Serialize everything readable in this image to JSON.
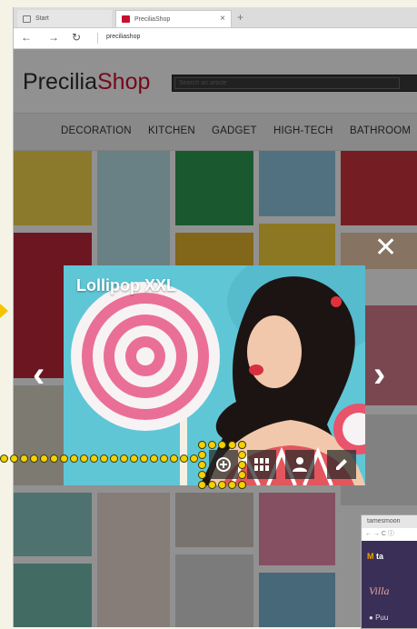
{
  "browser": {
    "tabs": [
      {
        "label": "Start"
      },
      {
        "label": "PreciliaShop"
      }
    ],
    "url": "preciliashop"
  },
  "shop": {
    "logo": {
      "part1": "Precilia",
      "part2": "Shop"
    },
    "search_placeholder": "Search an article",
    "categories": [
      "DECORATION",
      "KITCHEN",
      "GADGET",
      "HIGH-TECH",
      "BATHROOM"
    ]
  },
  "lightbox": {
    "title": "Lollipop XXL",
    "prev_icon": "chevron-left-icon",
    "next_icon": "chevron-right-icon",
    "close_icon": "close-icon",
    "toolbar_icons": [
      "zoom-in-icon",
      "grid-icon",
      "user-icon",
      "edit-icon"
    ]
  },
  "second_window": {
    "tab": "tamesmoon",
    "logo_initial": "M",
    "logo_text": "ta",
    "heading": "Villa",
    "location_text": "Puu"
  },
  "colors": {
    "brand": "#c8102e",
    "annotation": "#f4d100",
    "lightbox_bg": "#5bc4d4"
  }
}
